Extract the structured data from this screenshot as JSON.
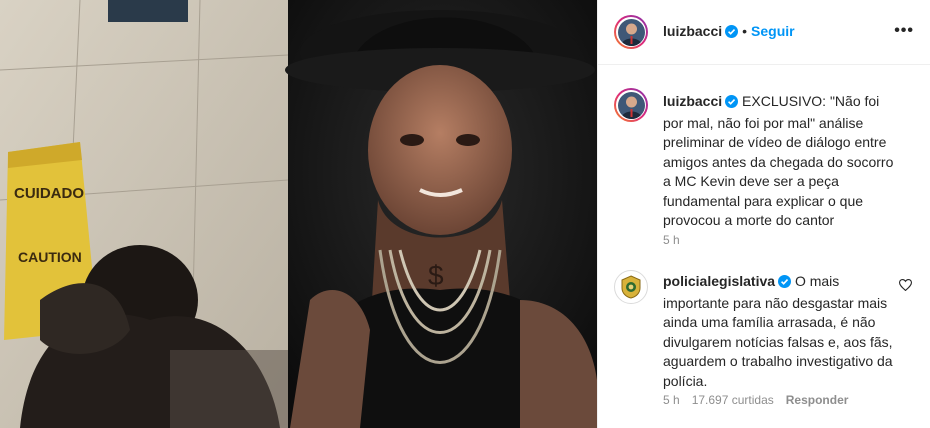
{
  "post": {
    "username": "luizbacci",
    "follow_label": "Seguir",
    "more_label": "•••",
    "caption_username": "luizbacci",
    "caption": "EXCLUSIVO: \"Não foi por mal, não foi por mal\" análise preliminar de vídeo de diálogo entre amigos antes da chegada do socorro a MC Kevin deve ser a peça fundamental para explicar o que provocou a morte do cantor",
    "caption_time": "5 h"
  },
  "media": {
    "sign_line1": "CUIDADO",
    "sign_line2": "CAUTION"
  },
  "comment": {
    "username": "policialegislativa",
    "text": "O mais importante para não desgastar mais ainda uma família arrasada, é não divulgarem notícias falsas e, aos fãs, aguardem o trabalho investigativo da polícia.",
    "time": "5 h",
    "likes": "17.697 curtidas",
    "reply_label": "Responder"
  },
  "colors": {
    "accent": "#0095f6",
    "muted": "#8e8e8e",
    "text": "#262626"
  }
}
